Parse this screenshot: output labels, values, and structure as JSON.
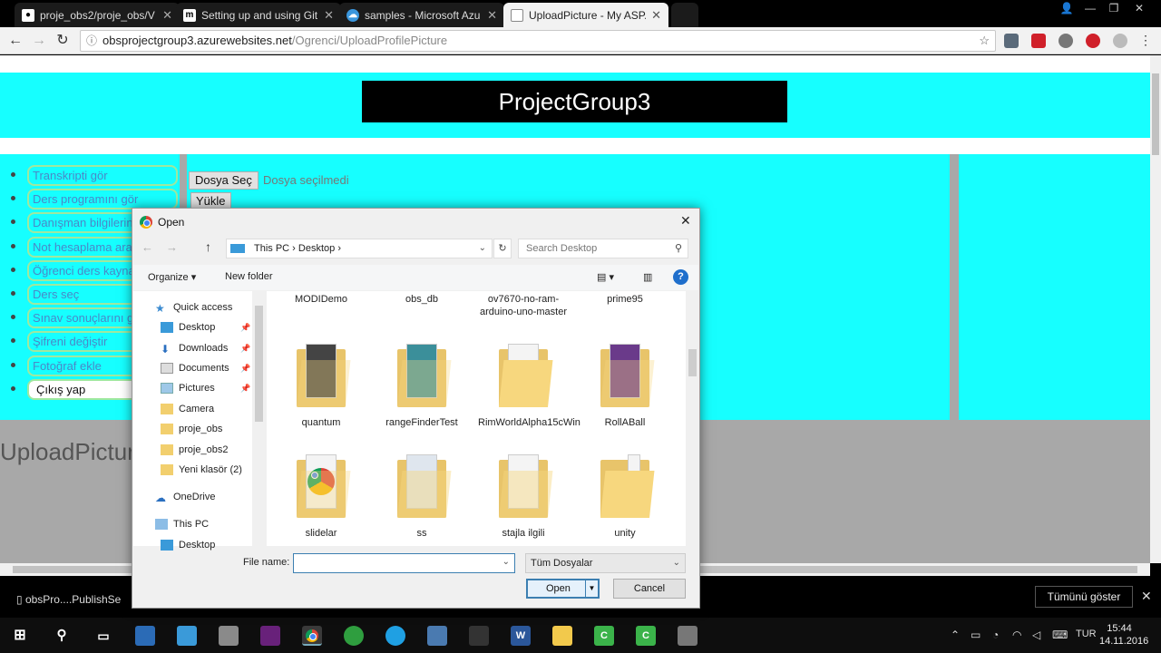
{
  "browser": {
    "tabs": [
      {
        "label": "proje_obs2/proje_obs/V",
        "icon": "github-icon"
      },
      {
        "label": "Setting up and using Git",
        "icon": "medium-icon"
      },
      {
        "label": "samples - Microsoft Azu",
        "icon": "azure-cloud-icon"
      },
      {
        "label": "UploadPicture - My ASP.",
        "icon": "page-icon"
      }
    ],
    "url_host": "obsprojectgroup3.azurewebsites.net",
    "url_path": "/Ogrenci/UploadProfilePicture"
  },
  "page": {
    "brand": "ProjectGroup3",
    "sidebar": [
      "Transkripti gör",
      "Ders programını gör",
      "Danışman bilgilerini gör",
      "Not hesaplama aracı",
      "Öğrenci ders kaynakları",
      "Ders seç",
      "Sınav sonuçlarını gör",
      "Şifreni değiştir",
      "Fotoğraf ekle",
      "Çıkış yap"
    ],
    "file_button": "Dosya Seç",
    "no_file_text": "Dosya seçilmedi",
    "upload_button": "Yükle",
    "upload_title": "UploadPicture"
  },
  "dialog": {
    "title": "Open",
    "address": [
      "This PC",
      "Desktop"
    ],
    "search_placeholder": "Search Desktop",
    "organize": "Organize ▾",
    "new_folder": "New folder",
    "nav_items": [
      "Quick access",
      "Desktop",
      "Downloads",
      "Documents",
      "Pictures",
      "Camera",
      "proje_obs",
      "proje_obs2",
      "Yeni klasör (2)",
      "OneDrive",
      "This PC",
      "Desktop"
    ],
    "files_row1": [
      "MODIDemo",
      "obs_db",
      "ov7670-no-ram-arduino-uno-master",
      "prime95"
    ],
    "files_row2": [
      "quantum",
      "rangeFinderTest",
      "RimWorldAlpha15cWin",
      "RollABall"
    ],
    "files_row3": [
      "slidelar",
      "ss",
      "stajla ilgili",
      "unity"
    ],
    "file_name_label": "File name:",
    "file_name_value": "",
    "file_type": "Tüm Dosyalar",
    "open_button": "Open",
    "cancel_button": "Cancel"
  },
  "downloads": {
    "item": "obsPro....PublishSe",
    "show_all": "Tümünü göster"
  },
  "taskbar": {
    "language": "TUR",
    "time": "15:44",
    "date": "14.11.2016"
  }
}
